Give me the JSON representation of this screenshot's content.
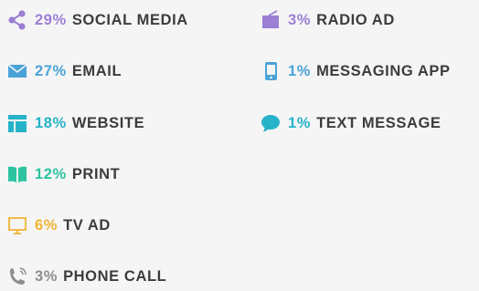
{
  "colors": {
    "purple": "#9b7fd4",
    "blue": "#4aa3d8",
    "teal": "#26b3c9",
    "green": "#2dc3a0",
    "gold": "#f0b433",
    "gray": "#8c8c8c",
    "label": "#3c3c3c"
  },
  "items": [
    {
      "icon": "share-icon",
      "percent": "29%",
      "label": "SOCIAL MEDIA",
      "color": "#9b7fd4"
    },
    {
      "icon": "envelope-icon",
      "percent": "27%",
      "label": "EMAIL",
      "color": "#4aa3d8"
    },
    {
      "icon": "website-icon",
      "percent": "18%",
      "label": "WEBSITE",
      "color": "#26b3c9"
    },
    {
      "icon": "book-icon",
      "percent": "12%",
      "label": "PRINT",
      "color": "#2dc3a0"
    },
    {
      "icon": "monitor-icon",
      "percent": "6%",
      "label": "TV AD",
      "color": "#f0b433"
    },
    {
      "icon": "phone-icon",
      "percent": "3%",
      "label": "PHONE CALL",
      "color": "#8c8c8c"
    },
    {
      "icon": "radio-icon",
      "percent": "3%",
      "label": "RADIO AD",
      "color": "#9b7fd4"
    },
    {
      "icon": "mobile-icon",
      "percent": "1%",
      "label": "MESSAGING APP",
      "color": "#4aa3d8"
    },
    {
      "icon": "chat-bubble-icon",
      "percent": "1%",
      "label": "TEXT MESSAGE",
      "color": "#26b3c9"
    }
  ]
}
